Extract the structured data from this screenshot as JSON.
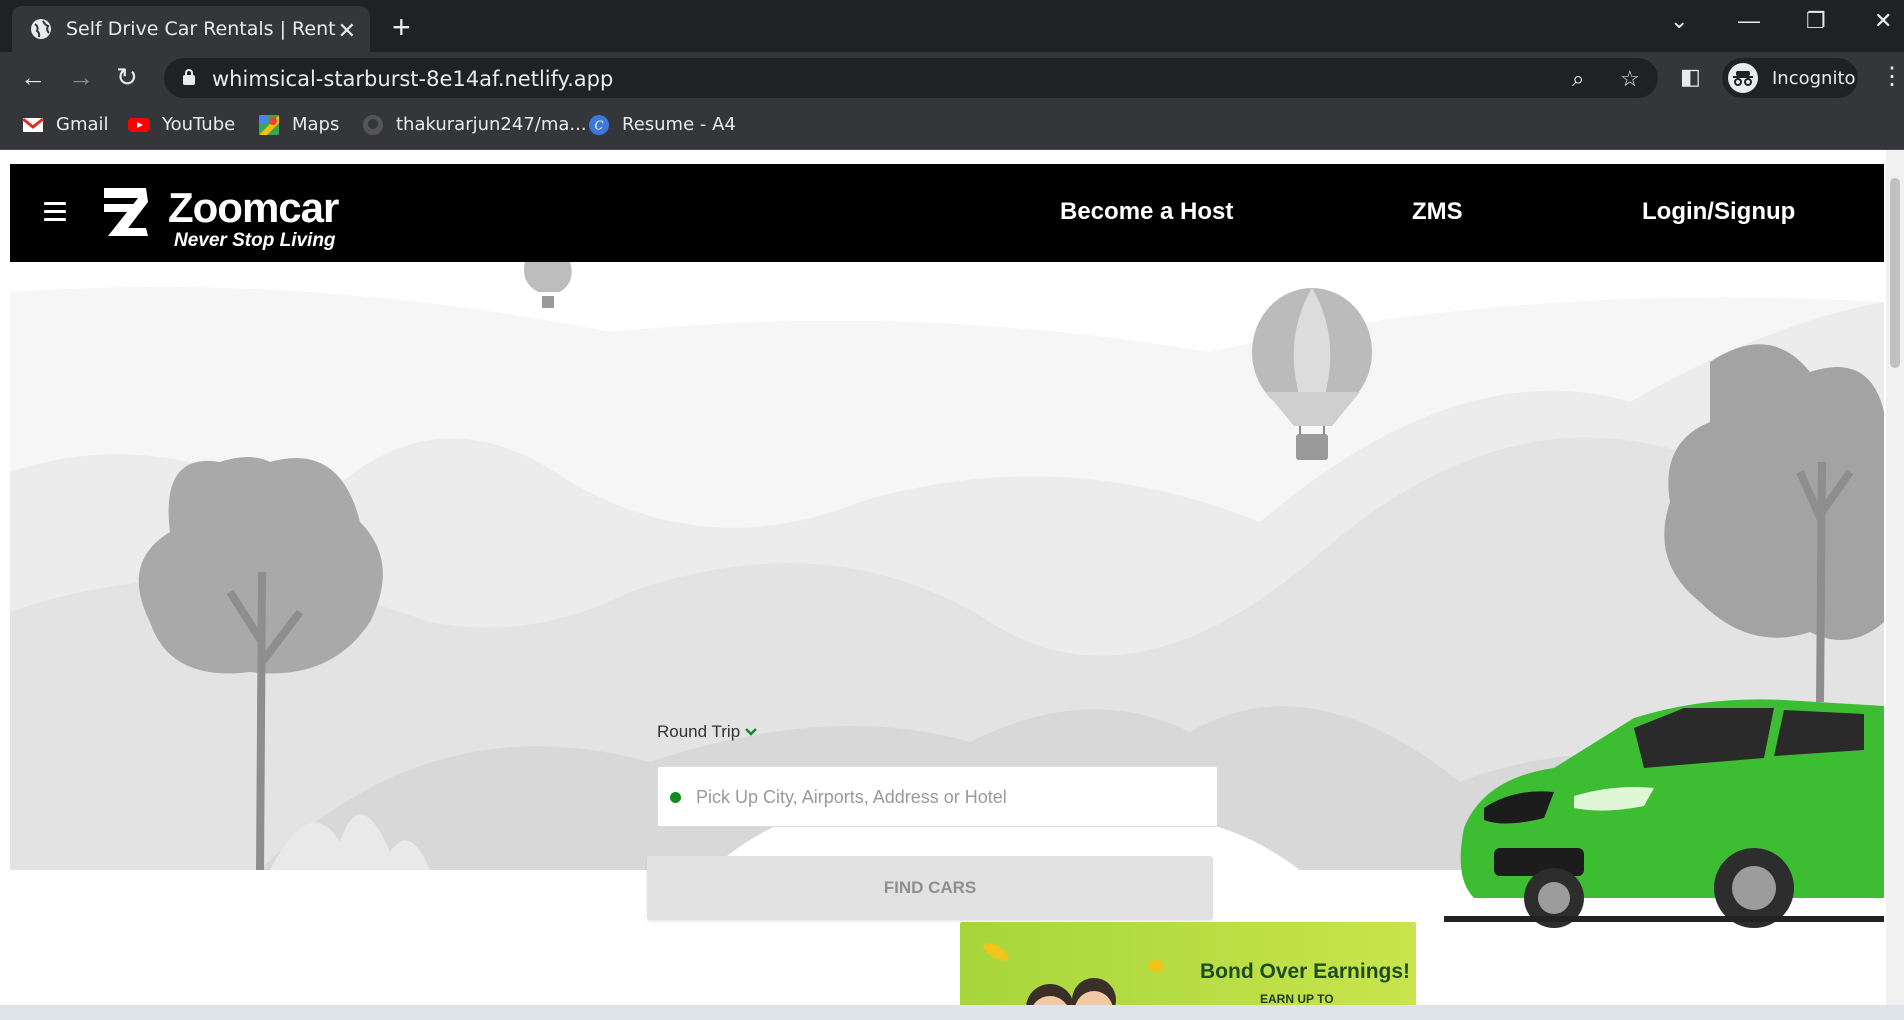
{
  "browser": {
    "tab_title": "Self Drive Car Rentals | Rent a Car",
    "url": "whimsical-starburst-8e14af.netlify.app",
    "profile_label": "Incognito",
    "bookmarks": [
      {
        "label": "Gmail",
        "icon": "gmail-icon"
      },
      {
        "label": "YouTube",
        "icon": "youtube-icon"
      },
      {
        "label": "Maps",
        "icon": "maps-icon"
      },
      {
        "label": "thakurarjun247/ma...",
        "icon": "github-icon"
      },
      {
        "label": "Resume - A4",
        "icon": "canva-icon"
      }
    ]
  },
  "site": {
    "brand": "Zoomcar",
    "tagline": "Never Stop Living",
    "nav": [
      "Become a Host",
      "ZMS",
      "Login/Signup"
    ]
  },
  "search": {
    "trip_type": "Round Trip",
    "pickup_placeholder": "Pick Up City, Airports, Address or Hotel",
    "pickup_value": "",
    "find_button": "FIND CARS"
  },
  "promo": {
    "title": "Bond Over Earnings!",
    "subtitle": "EARN UP TO"
  },
  "colors": {
    "accent_green": "#118a1f",
    "car_green": "#3dbd32",
    "header_bg": "#000000"
  }
}
